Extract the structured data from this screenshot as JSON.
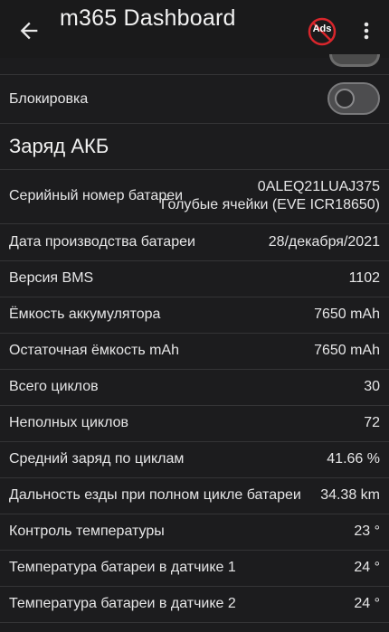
{
  "app": {
    "title": "m365 Dashboard",
    "ads_label": "Ads"
  },
  "lock": {
    "label": "Блокировка",
    "enabled": false
  },
  "section": {
    "title": "Заряд АКБ"
  },
  "serial": {
    "label": "Серийный номер батареи",
    "value": "0ALEQ21LUAJ375",
    "cells": "Голубые ячейки (EVE ICR18650)"
  },
  "rows": [
    {
      "label": "Дата производства батареи",
      "value": "28/декабря/2021"
    },
    {
      "label": "Версия BMS",
      "value": "1102"
    },
    {
      "label": "Ёмкость аккумулятора",
      "value": "7650 mAh"
    },
    {
      "label": "Остаточная ёмкость mAh",
      "value": "7650 mAh"
    },
    {
      "label": "Всего циклов",
      "value": "30"
    },
    {
      "label": "Неполных циклов",
      "value": "72"
    },
    {
      "label": "Средний заряд по циклам",
      "value": "41.66 %"
    },
    {
      "label": "Дальность езды при полном цикле батареи",
      "value": "34.38 km"
    },
    {
      "label": "Контроль температуры",
      "value": "23 °"
    },
    {
      "label": "Температура батареи в датчике 1",
      "value": "24 °"
    },
    {
      "label": "Температура батареи в датчике 2",
      "value": "24 °"
    }
  ]
}
